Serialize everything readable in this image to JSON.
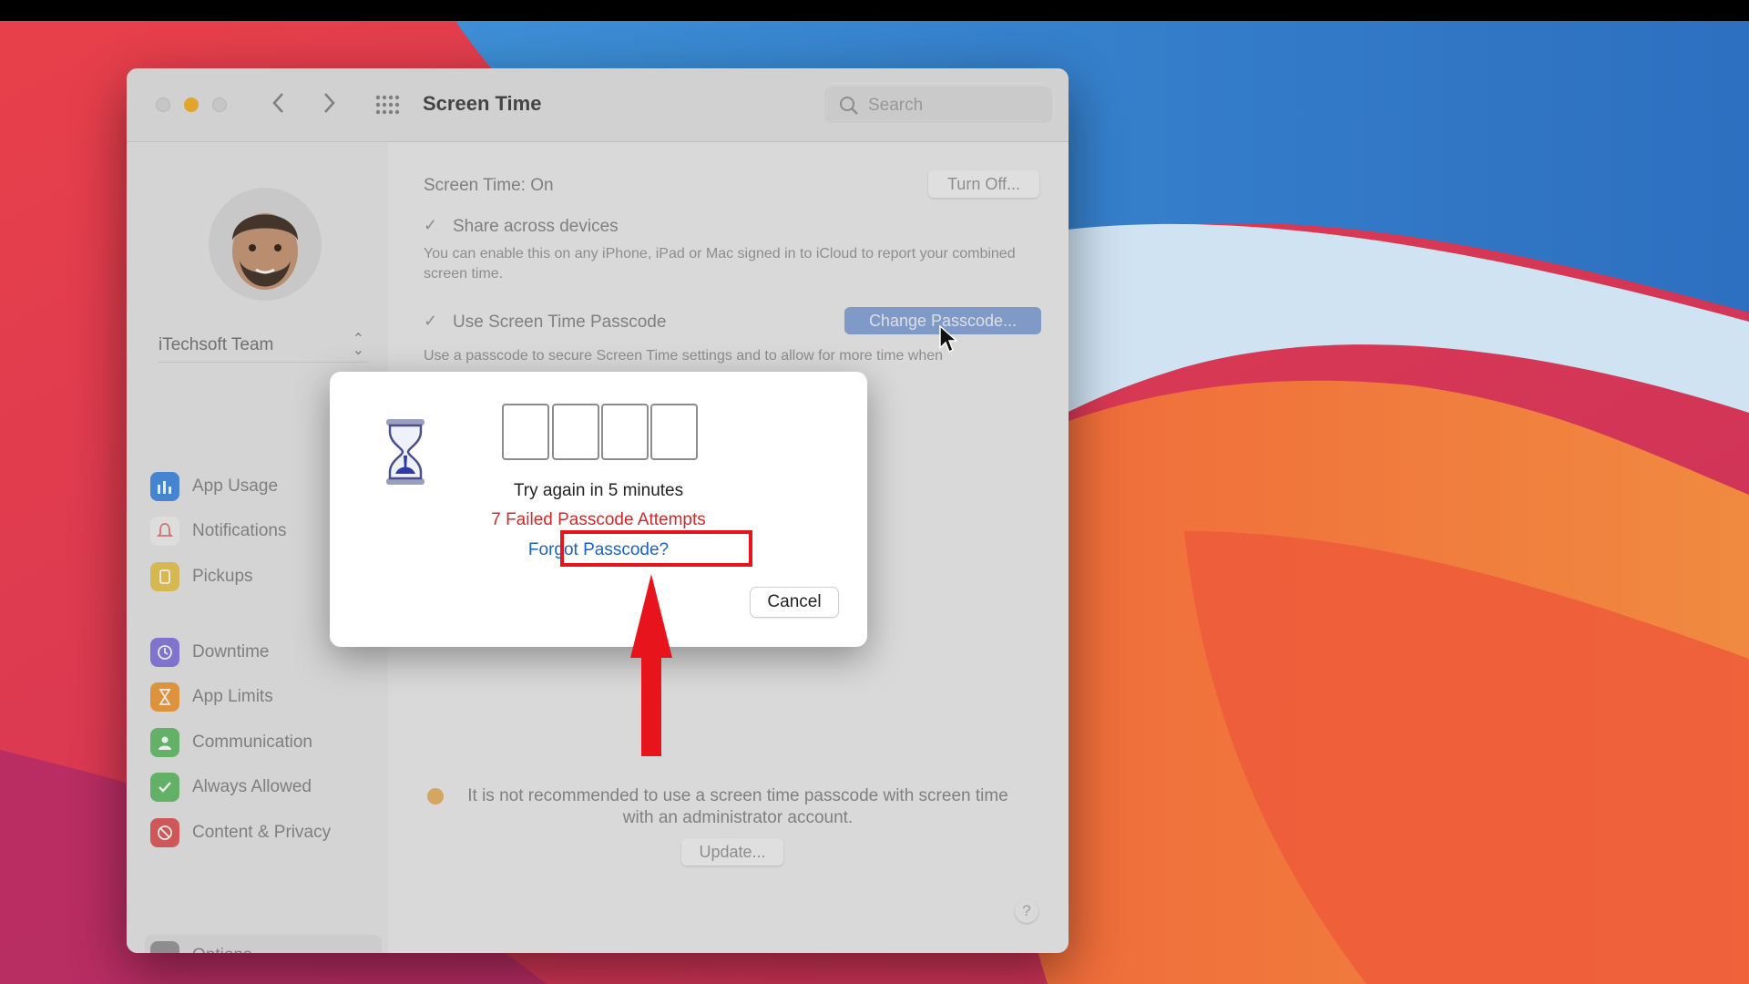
{
  "window": {
    "title": "Screen Time",
    "search_placeholder": "Search"
  },
  "sidebar": {
    "account_name": "iTechsoft Team",
    "items": [
      {
        "label": "App Usage",
        "icon": "app-usage-icon",
        "color": "#4a90e2"
      },
      {
        "label": "Notifications",
        "icon": "bell-icon",
        "color": "#e57a7a"
      },
      {
        "label": "Pickups",
        "icon": "pickups-icon",
        "color": "#e8c85a"
      },
      {
        "label": "Downtime",
        "icon": "downtime-icon",
        "color": "#8a7de0"
      },
      {
        "label": "App Limits",
        "icon": "hourglass-icon",
        "color": "#f0a040"
      },
      {
        "label": "Communication",
        "icon": "communication-icon",
        "color": "#6cc070"
      },
      {
        "label": "Always Allowed",
        "icon": "checkmark-icon",
        "color": "#6cc070"
      },
      {
        "label": "Content & Privacy",
        "icon": "no-entry-icon",
        "color": "#e06060"
      }
    ],
    "options_label": "Options"
  },
  "main": {
    "screen_time_label": "Screen Time:",
    "screen_time_value": "On",
    "turn_off_button": "Turn Off...",
    "share_label": "Share across devices",
    "share_desc": "You can enable this on any iPhone, iPad or Mac signed in to iCloud to report your combined screen time.",
    "passcode_label": "Use Screen Time Passcode",
    "change_passcode_button": "Change Passcode...",
    "passcode_desc": "Use a passcode to secure Screen Time settings and to allow for more time when",
    "warning_text": "It is not recommended to use a screen time passcode with screen time with an administrator account.",
    "update_button": "Update...",
    "help_button": "?"
  },
  "dialog": {
    "retry_text": "Try again in 5 minutes",
    "failed_text": "7 Failed Passcode Attempts",
    "forgot_link": "Forgot Passcode?",
    "cancel_button": "Cancel"
  },
  "colors": {
    "accent_blue": "#1a62c7",
    "error_red": "#d12a2a",
    "highlight_red": "#e8141b"
  }
}
